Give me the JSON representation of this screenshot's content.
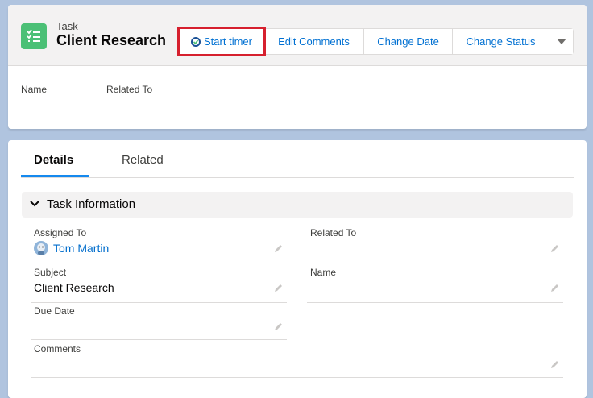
{
  "header": {
    "object_label": "Task",
    "record_title": "Client Research",
    "actions": {
      "start_timer": "Start timer",
      "edit_comments": "Edit Comments",
      "change_date": "Change Date",
      "change_status": "Change Status"
    },
    "highlight_fields": {
      "name_label": "Name",
      "related_to_label": "Related To"
    }
  },
  "tabs": {
    "details": "Details",
    "related": "Related"
  },
  "section": {
    "title": "Task Information"
  },
  "fields": {
    "assigned_to": {
      "label": "Assigned To",
      "value": "Tom Martin"
    },
    "related_to": {
      "label": "Related To",
      "value": ""
    },
    "subject": {
      "label": "Subject",
      "value": "Client Research"
    },
    "name": {
      "label": "Name",
      "value": ""
    },
    "due_date": {
      "label": "Due Date",
      "value": ""
    },
    "comments": {
      "label": "Comments",
      "value": ""
    }
  },
  "colors": {
    "brand_blue": "#0070d2",
    "task_green": "#4bc076",
    "highlight_red": "#d6202e",
    "tab_active": "#1589ee"
  }
}
